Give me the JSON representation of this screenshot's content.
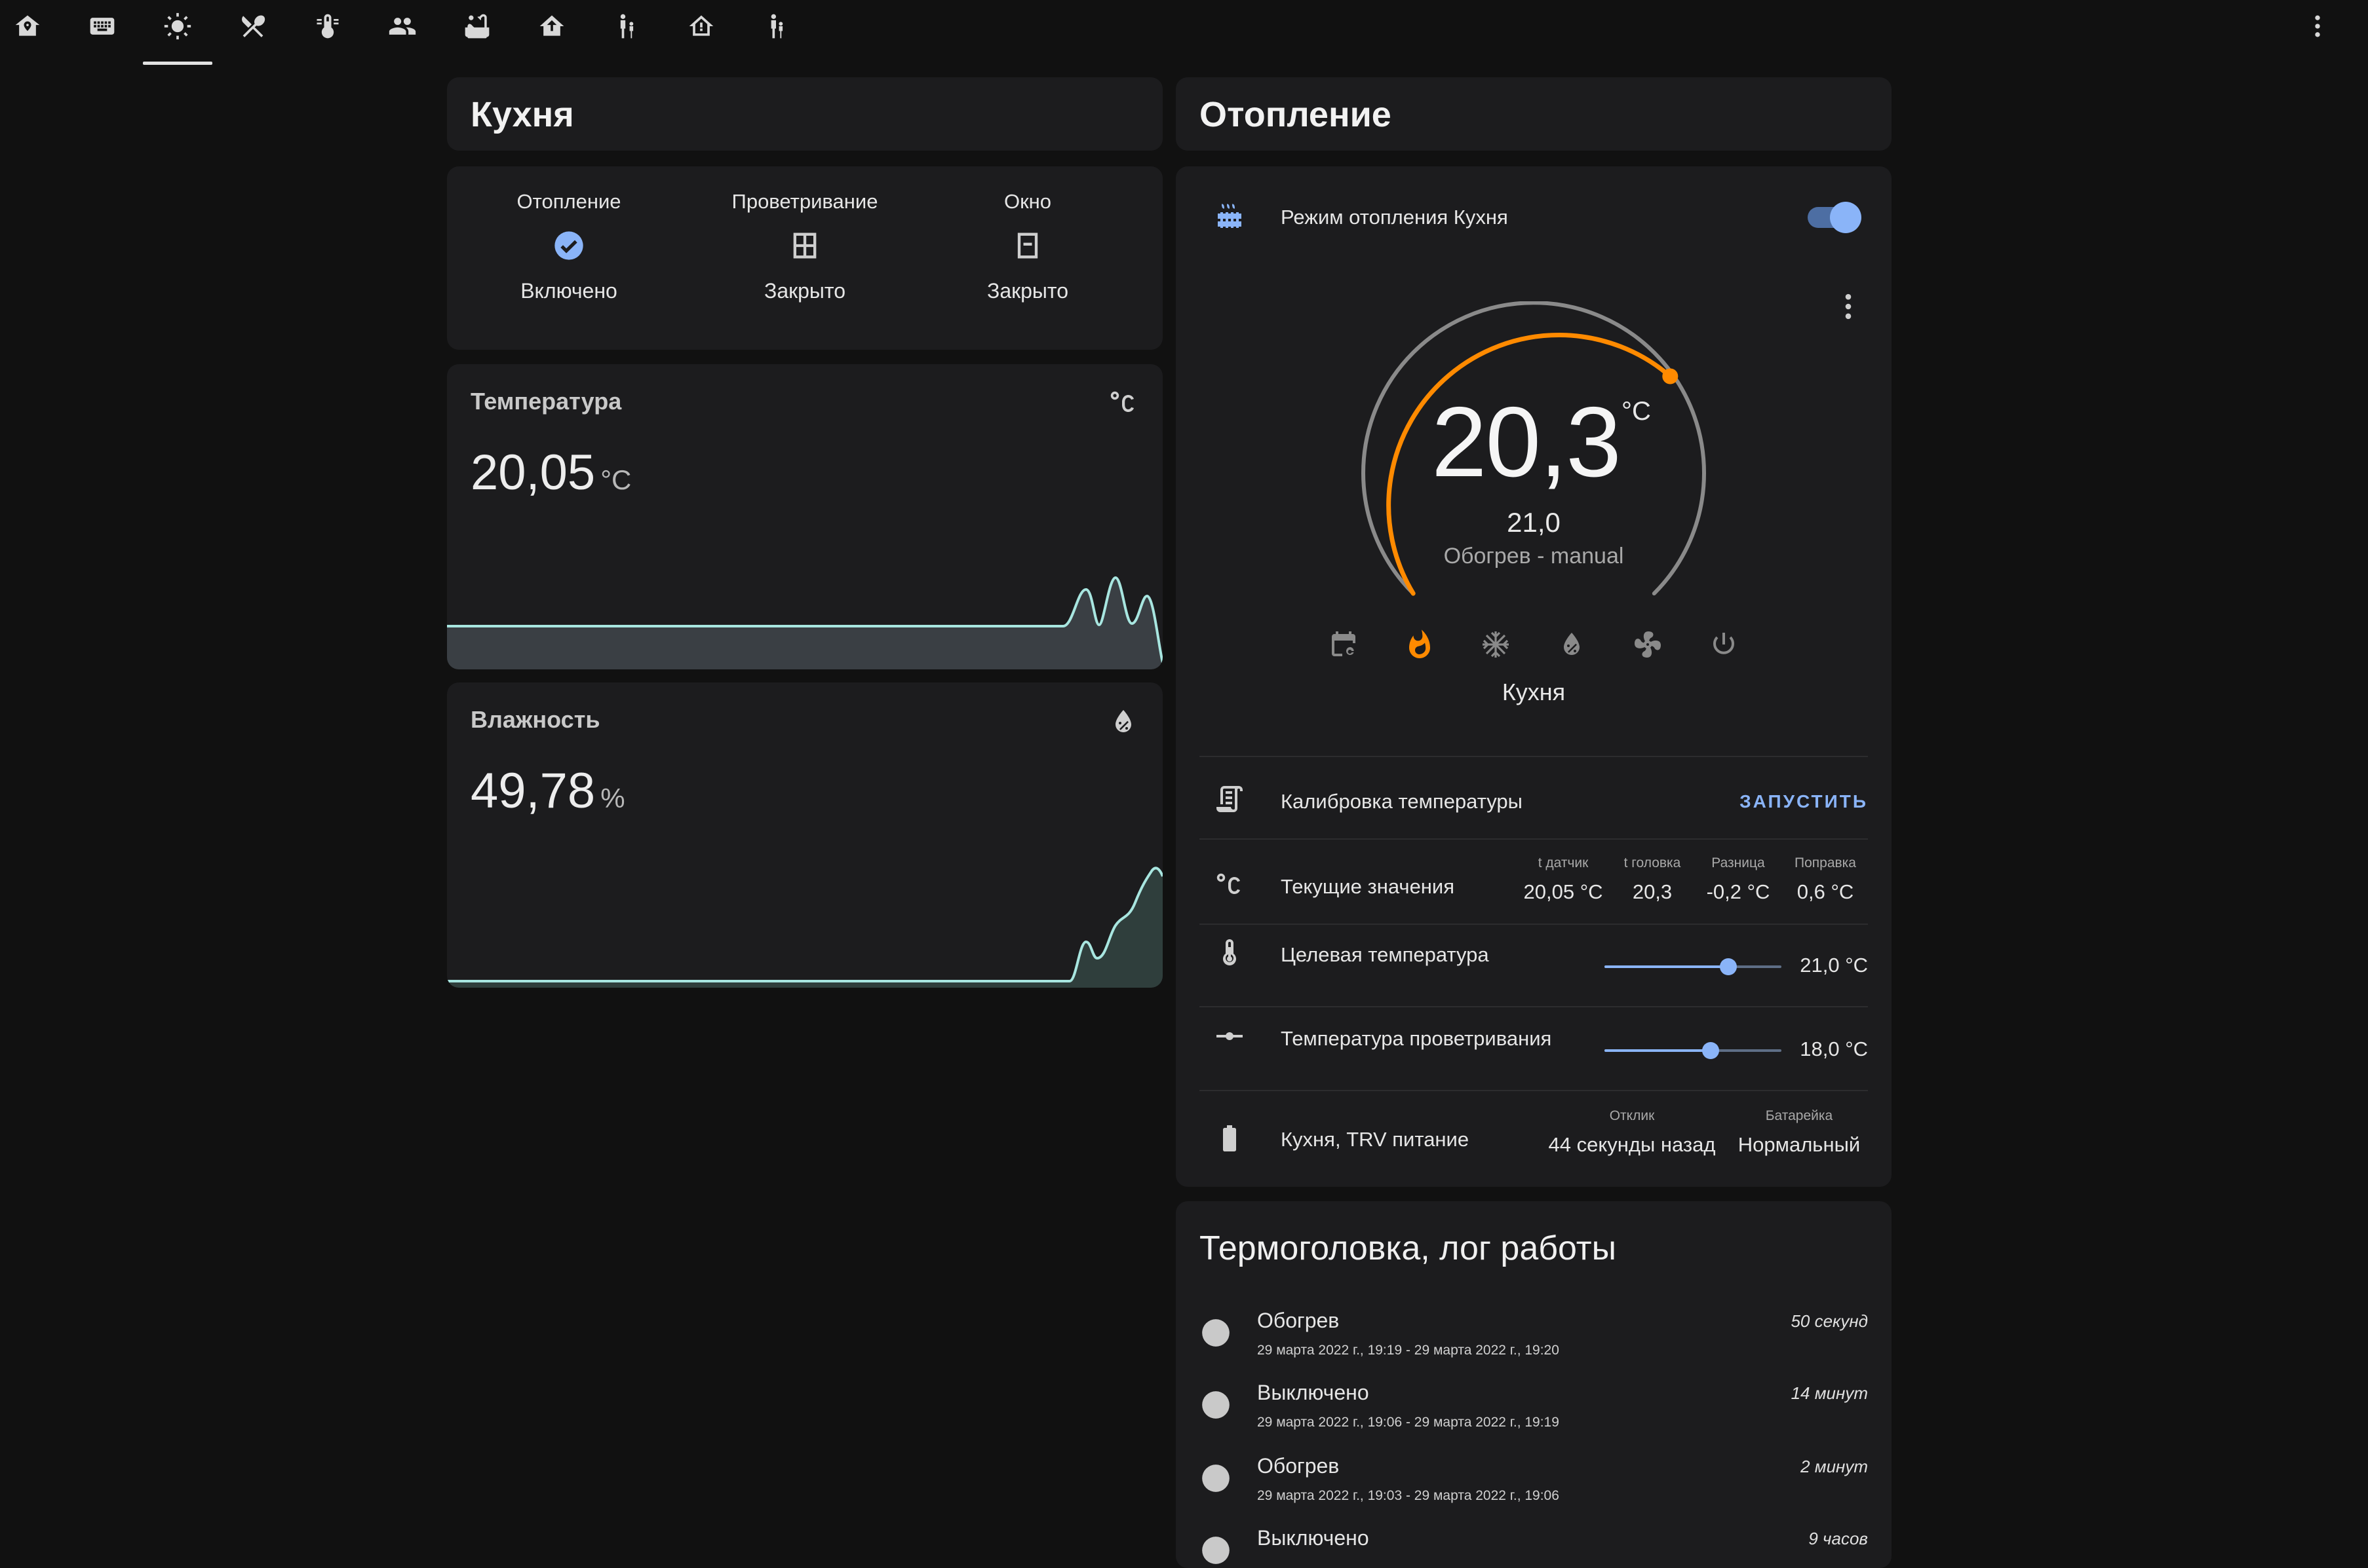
{
  "toolbar": {
    "tabs": [
      "home-shield-icon",
      "keyboard-icon",
      "kitchen-sun-icon",
      "cutlery-icon",
      "thermometer-lines-icon",
      "people-icon",
      "bathtub-icon",
      "home-arrow-icon",
      "person-child-icon",
      "home-alert-icon",
      "child-icon"
    ],
    "active_tab_index": 2
  },
  "kitchen": {
    "title": "Кухня",
    "glance": [
      {
        "name": "Отопление",
        "state": "Включено",
        "icon": "check-circle-icon"
      },
      {
        "name": "Проветривание",
        "state": "Закрыто",
        "icon": "window-icon"
      },
      {
        "name": "Окно",
        "state": "Закрыто",
        "icon": "window-closed-icon"
      }
    ],
    "temperature": {
      "name": "Температура",
      "value": "20,05",
      "unit": "°C",
      "icon": "celsius-icon"
    },
    "humidity": {
      "name": "Влажность",
      "value": "49,78",
      "unit": "%",
      "icon": "water-percent-icon"
    }
  },
  "heating": {
    "title": "Отопление",
    "mode_switch": {
      "label": "Режим отопления Кухня",
      "on": true
    },
    "thermostat": {
      "current": "20,3",
      "unit": "°C",
      "target": "21,0",
      "mode": "Обогрев - manual",
      "name": "Кухня",
      "hvac_modes": [
        "calendar-auto-icon",
        "fire-icon",
        "snowflake-icon",
        "water-percent-icon",
        "fan-icon",
        "power-icon"
      ],
      "active_mode_index": 1,
      "accent": "#ff8a00"
    },
    "calibration": {
      "label": "Калибровка температуры",
      "button": "ЗАПУСТИТЬ"
    },
    "current_values": {
      "label": "Текущие значения",
      "columns": [
        {
          "header": "t датчик",
          "value": "20,05 °C"
        },
        {
          "header": "t головка",
          "value": "20,3"
        },
        {
          "header": "Разница",
          "value": "-0,2 °C"
        },
        {
          "header": "Поправка",
          "value": "0,6 °C"
        }
      ]
    },
    "target_temp": {
      "label": "Целевая температура",
      "value": "21,0 °C",
      "fraction": 0.7
    },
    "vent_temp": {
      "label": "Температура проветривания",
      "value": "18,0 °C",
      "fraction": 0.6
    },
    "power": {
      "label": "Кухня, TRV питание",
      "columns": [
        {
          "header": "Отклик",
          "value": "44 секунды назад"
        },
        {
          "header": "Батарейка",
          "value": "Нормальный"
        }
      ]
    }
  },
  "log": {
    "title": "Термоголовка, лог работы",
    "items": [
      {
        "state": "Обогрев",
        "time": "29 марта 2022 г., 19:19 - 29 марта 2022 г., 19:20",
        "duration": "50 секунд"
      },
      {
        "state": "Выключено",
        "time": "29 марта 2022 г., 19:06 - 29 марта 2022 г., 19:19",
        "duration": "14 минут"
      },
      {
        "state": "Обогрев",
        "time": "29 марта 2022 г., 19:03 - 29 марта 2022 г., 19:06",
        "duration": "2 минут"
      },
      {
        "state": "Выключено",
        "time": "",
        "duration": "9 часов"
      }
    ]
  },
  "colors": {
    "background": "#111111",
    "card": "#1c1c1e",
    "accent_blue": "#8ab4f8",
    "accent_orange": "#ff8a00",
    "spark_line": "#a8e6e0"
  }
}
